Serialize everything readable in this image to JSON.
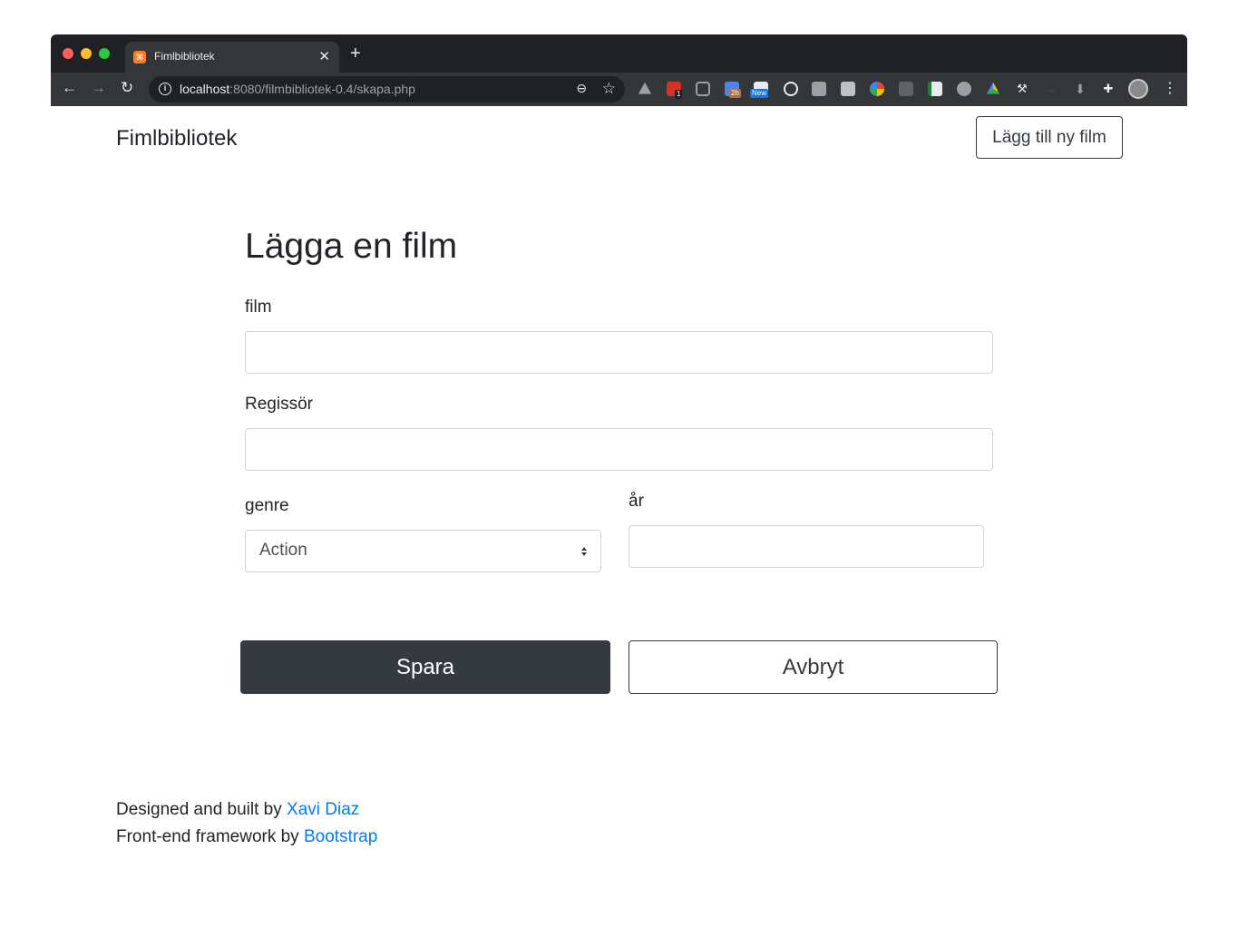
{
  "browser": {
    "tab_title": "Fimlbibliotek",
    "tab_favicon_text": "⌘",
    "url_host": "localhost",
    "url_rest": ":8080/filmbibliotek-0.4/skapa.php",
    "extension_badges": {
      "ext2": "1",
      "ext4": "2h",
      "ext5": "New"
    }
  },
  "navbar": {
    "brand": "Fimlbibliotek",
    "add_button_label": "Lägg till ny film"
  },
  "form": {
    "heading": "Lägga en film",
    "film_label": "film",
    "film_value": "",
    "director_label": "Regissör",
    "director_value": "",
    "genre_label": "genre",
    "genre_selected": "Action",
    "year_label": "år",
    "year_value": "",
    "save_label": "Spara",
    "cancel_label": "Avbryt"
  },
  "footer": {
    "line1_prefix": "Designed and built by ",
    "line1_link": "Xavi Diaz",
    "line2_prefix": "Front-end framework by ",
    "line2_link": "Bootstrap"
  },
  "colors": {
    "dark": "#343a40",
    "link": "#007bff",
    "chrome_bg": "#202124",
    "toolbar_bg": "#35363a"
  }
}
